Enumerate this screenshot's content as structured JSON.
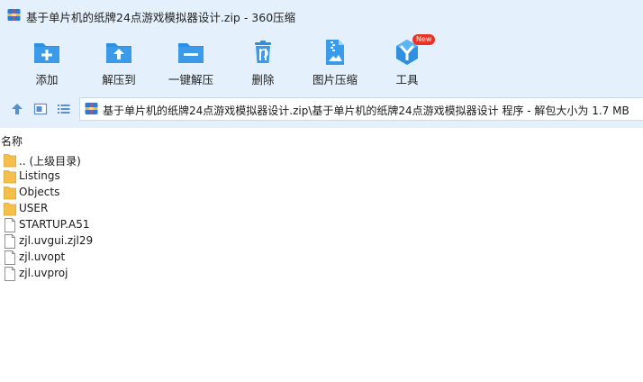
{
  "window": {
    "title": "基于单片机的纸牌24点游戏模拟器设计.zip - 360压缩"
  },
  "toolbar": {
    "items": [
      {
        "label": "添加",
        "icon": "add-folder-icon"
      },
      {
        "label": "解压到",
        "icon": "extract-to-icon"
      },
      {
        "label": "一键解压",
        "icon": "one-click-extract-icon"
      },
      {
        "label": "删除",
        "icon": "trash-icon"
      },
      {
        "label": "图片压缩",
        "icon": "image-compress-icon"
      },
      {
        "label": "工具",
        "icon": "tools-icon",
        "badge": "New"
      }
    ]
  },
  "addressbar": {
    "path": "基于单片机的纸牌24点游戏模拟器设计.zip\\基于单片机的纸牌24点游戏模拟器设计 程序 - 解包大小为 1.7 MB"
  },
  "list": {
    "column_name": "名称",
    "items": [
      {
        "name": ".. (上级目录)",
        "type": "folder"
      },
      {
        "name": "Listings",
        "type": "folder"
      },
      {
        "name": "Objects",
        "type": "folder"
      },
      {
        "name": "USER",
        "type": "folder"
      },
      {
        "name": "STARTUP.A51",
        "type": "file"
      },
      {
        "name": "zjl.uvgui.zjl29",
        "type": "file"
      },
      {
        "name": "zjl.uvopt",
        "type": "file"
      },
      {
        "name": "zjl.uvproj",
        "type": "file"
      }
    ]
  },
  "colors": {
    "chrome": "#e4f0fb",
    "accent": "#2f8fe0",
    "folder": "#f5c04a",
    "badge": "#ea3323"
  }
}
